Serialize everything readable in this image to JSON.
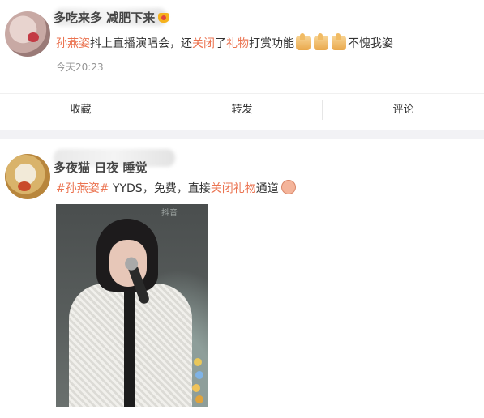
{
  "posts": [
    {
      "nickname": "多吃来多 减肥下来",
      "content_parts": {
        "link1": "孙燕姿",
        "text1": "抖上直播演唱会，还",
        "link2": "关闭",
        "text2": "了",
        "link3": "礼物",
        "text3": "打赏功能",
        "text4": "不愧我姿"
      },
      "time": "今天20:23",
      "actions": {
        "favorite": "收藏",
        "repost": "转发",
        "comment": "评论"
      }
    },
    {
      "nickname": "多夜猫 日夜 睡觉",
      "content_parts": {
        "topic": "#孙燕姿#",
        "text1": " YYDS，免费，直接",
        "link1": "关闭礼物",
        "text2": "通道"
      },
      "photo_watermark": "抖音"
    }
  ],
  "icons": {
    "crown": "crown-icon",
    "thumbs": "thumbs-up-icon",
    "emoji": "pray-emoji-icon"
  },
  "colors": {
    "link": "#eb7350",
    "text": "#333333",
    "time": "#939393"
  }
}
